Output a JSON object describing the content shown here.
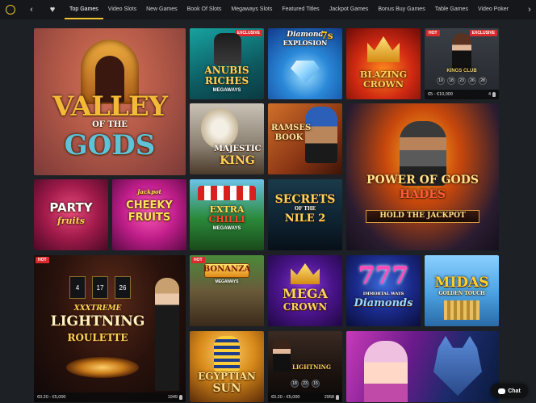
{
  "nav": {
    "tabs": [
      {
        "label": "Top Games",
        "active": true
      },
      {
        "label": "Video Slots"
      },
      {
        "label": "New Games"
      },
      {
        "label": "Book Of Slots"
      },
      {
        "label": "Megaways Slots"
      },
      {
        "label": "Featured Titles"
      },
      {
        "label": "Jackpot Games"
      },
      {
        "label": "Bonus Buy Games"
      },
      {
        "label": "Table Games"
      },
      {
        "label": "Video Poker"
      }
    ]
  },
  "games": {
    "valley": {
      "title_line1": "VALLEY",
      "title_line2": "OF THE",
      "title_line3": "GODS"
    },
    "anubis": {
      "badge": "EXCLUSIVE",
      "title_line1": "ANUBIS",
      "title_line2": "RICHES",
      "subtitle": "MEGAWAYS"
    },
    "diamond": {
      "title_line1": "Diamond",
      "title_line2": "EXPLOSION",
      "title_num": "7s"
    },
    "blazing": {
      "title_line1": "BLAZING",
      "title_line2": "CROWN"
    },
    "kings": {
      "badge_hot": "HOT",
      "badge_exclusive": "EXCLUSIVE",
      "title": "KINGS CLUB",
      "numbers": [
        "10",
        "18",
        "23",
        "26",
        "28"
      ],
      "limits": "€5 - €10,000",
      "players": "4"
    },
    "lion": {
      "title_line1": "MAJESTIC",
      "title_line2": "KING"
    },
    "ramses": {
      "title_line1": "RAMSES",
      "title_line2": "BOOK"
    },
    "power": {
      "title_line1": "POWER OF GODS",
      "title_line2": "HADES",
      "title_line3": "HOLD THE JACKPOT"
    },
    "party": {
      "title_line1": "PARTY",
      "title_line2": "fruits"
    },
    "cheeky": {
      "title_line1": "Jackpot",
      "title_line2": "CHEEKY",
      "title_line3": "FRUITS"
    },
    "extra": {
      "title_line1": "EXTRA",
      "title_line2": "CHILLI",
      "subtitle": "MEGAWAYS"
    },
    "secrets": {
      "title_line1": "SECRETS",
      "title_line2": "OF THE",
      "title_line3": "NILE 2"
    },
    "xxxtreme": {
      "badge": "HOT",
      "numbers": [
        "4",
        "17",
        "26"
      ],
      "title_line1": "XXXTREME",
      "title_line2": "LIGHTNING",
      "title_line3": "ROULETTE",
      "limits": "€0.20 - €5,000",
      "players": "1949"
    },
    "bonanza": {
      "badge": "HOT",
      "title": "BONANZA",
      "subtitle": "MEGAWAYS"
    },
    "mega": {
      "title_line1": "MEGA",
      "title_line2": "CROWN"
    },
    "immortal": {
      "title_line1": "IMMORTAL WAYS",
      "title_line2": "Diamonds"
    },
    "midas": {
      "title_line1": "MIDAS",
      "title_line2": "GOLDEN TOUCH"
    },
    "egyptian": {
      "title_line1": "EGYPTIAN",
      "title_line2": "SUN"
    },
    "lightning": {
      "title": "LIGHTNING",
      "numbers": [
        "18",
        "23",
        "15"
      ],
      "limits": "€0.20 - €5,000",
      "players": "2958"
    },
    "wolf": {}
  },
  "chat": {
    "label": "Chat"
  }
}
